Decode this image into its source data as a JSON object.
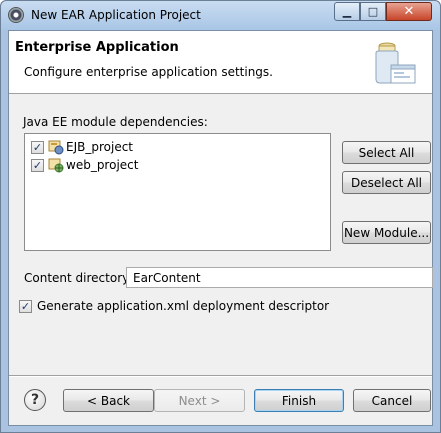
{
  "window": {
    "title": "New EAR Application Project",
    "minimize": "▁",
    "maximize": "□",
    "close": "✕",
    "icon": "eclipse-gear-icon"
  },
  "header": {
    "title": "Enterprise Application",
    "description": "Configure enterprise application settings.",
    "banner_icon": "jar-wizard-icon"
  },
  "modules": {
    "label": "Java EE module dependencies:",
    "items": [
      {
        "label": "EJB_project",
        "checked": true,
        "icon": "ejb-project-icon"
      },
      {
        "label": "web_project",
        "checked": true,
        "icon": "web-project-icon"
      }
    ],
    "select_all": "Select All",
    "deselect_all": "Deselect All",
    "new_module": "New Module..."
  },
  "content_directory": {
    "label": "Content directory:",
    "value": "EarContent"
  },
  "generate_descriptor": {
    "label": "Generate application.xml deployment descriptor",
    "checked": true
  },
  "footer": {
    "help_icon": "help-icon",
    "back": "< Back",
    "next": "Next >",
    "finish": "Finish",
    "cancel": "Cancel"
  },
  "colors": {
    "title_bar": "#a9c6e6",
    "close_button": "#c7452a",
    "dialog_bg": "#f0f0f0",
    "default_button_border": "#3c7fb1"
  }
}
